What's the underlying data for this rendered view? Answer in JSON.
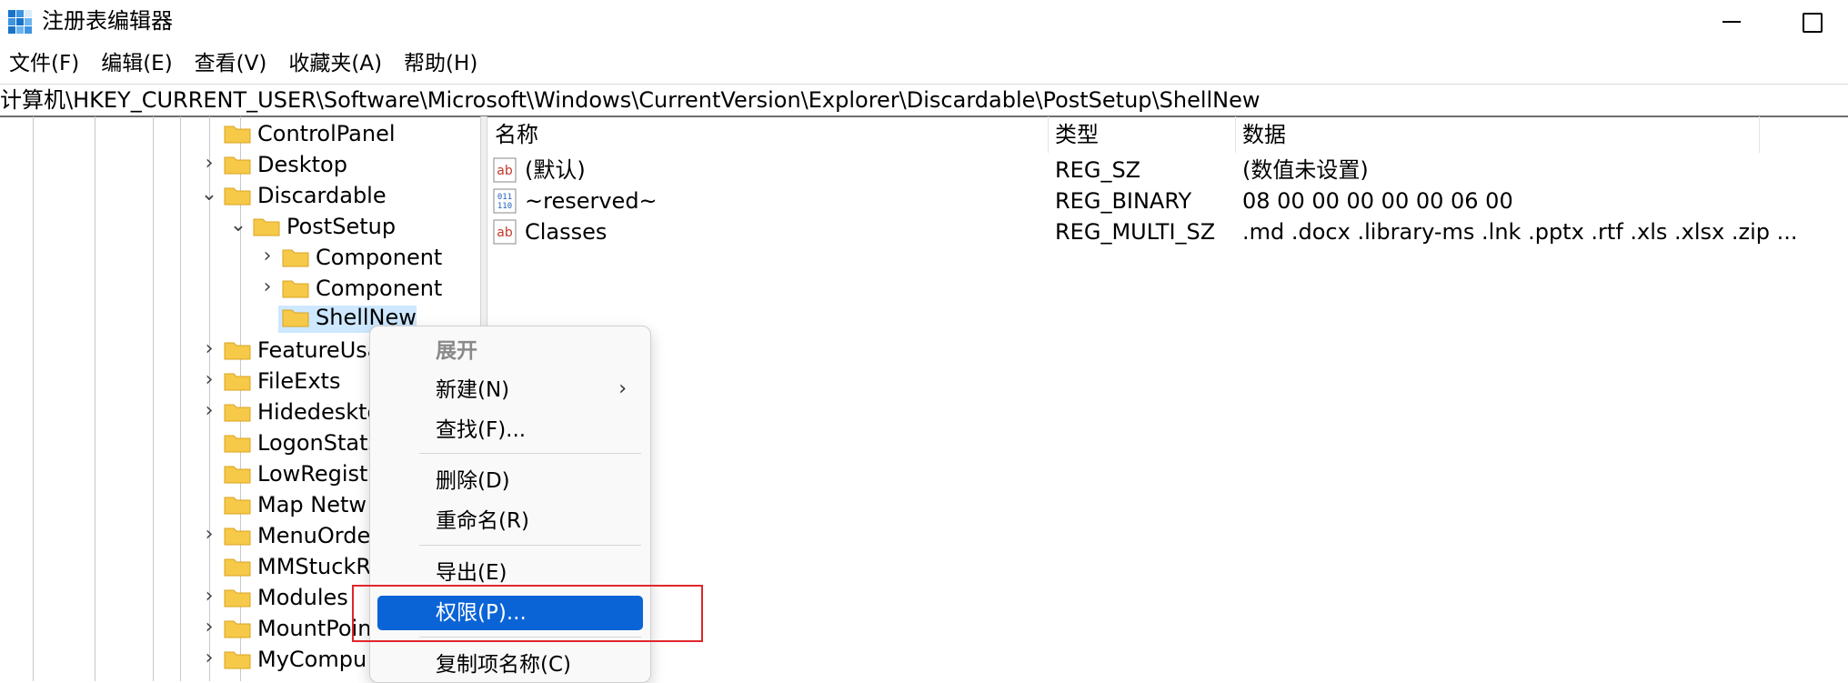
{
  "window": {
    "title": "注册表编辑器",
    "icon": "regedit-icon"
  },
  "menubar": [
    "文件(F)",
    "编辑(E)",
    "查看(V)",
    "收藏夹(A)",
    "帮助(H)"
  ],
  "address": "计算机\\HKEY_CURRENT_USER\\Software\\Microsoft\\Windows\\CurrentVersion\\Explorer\\Discardable\\PostSetup\\ShellNew",
  "tree": [
    {
      "label": "ControlPanel",
      "chevron": ""
    },
    {
      "label": "Desktop",
      "chevron": "›"
    },
    {
      "label": "Discardable",
      "chevron": "⌄"
    },
    {
      "label": "PostSetup",
      "chevron": "⌄"
    },
    {
      "label": "Component",
      "chevron": "›"
    },
    {
      "label": "Component",
      "chevron": "›"
    },
    {
      "label": "ShellNew",
      "chevron": "",
      "selected": true
    },
    {
      "label": "FeatureUsa",
      "chevron": "›"
    },
    {
      "label": "FileExts",
      "chevron": "›"
    },
    {
      "label": "Hidedeskto",
      "chevron": "›"
    },
    {
      "label": "LogonStats",
      "chevron": ""
    },
    {
      "label": "LowRegistr",
      "chevron": ""
    },
    {
      "label": "Map Netw",
      "chevron": ""
    },
    {
      "label": "MenuOrde",
      "chevron": "›"
    },
    {
      "label": "MMStuckR",
      "chevron": ""
    },
    {
      "label": "Modules",
      "chevron": "›"
    },
    {
      "label": "MountPoin",
      "chevron": "›"
    },
    {
      "label": "MyCompu",
      "chevron": "›"
    }
  ],
  "list": {
    "headers": {
      "name": "名称",
      "type": "类型",
      "data": "数据"
    },
    "rows": [
      {
        "icon": "string-value-icon",
        "name": "(默认)",
        "type": "REG_SZ",
        "data": "(数值未设置)"
      },
      {
        "icon": "binary-value-icon",
        "name": "~reserved~",
        "type": "REG_BINARY",
        "data": "08 00 00 00 00 00 06 00"
      },
      {
        "icon": "string-value-icon",
        "name": "Classes",
        "type": "REG_MULTI_SZ",
        "data": ".md .docx .library-ms .lnk .pptx .rtf .xls .xlsx .zip ..."
      }
    ]
  },
  "context_menu": {
    "items": [
      {
        "label": "展开",
        "disabled": true
      },
      {
        "label": "新建(N)",
        "submenu": "›"
      },
      {
        "label": "查找(F)..."
      },
      {
        "label": "删除(D)"
      },
      {
        "label": "重命名(R)"
      },
      {
        "label": "导出(E)"
      },
      {
        "label": "权限(P)...",
        "highlighted": true
      },
      {
        "label": "复制项名称(C)"
      }
    ]
  },
  "colors": {
    "highlight": "#0a64d6",
    "selection": "#cde8ff",
    "annotation_box": "#e0262b",
    "folder": "#f7c948"
  }
}
